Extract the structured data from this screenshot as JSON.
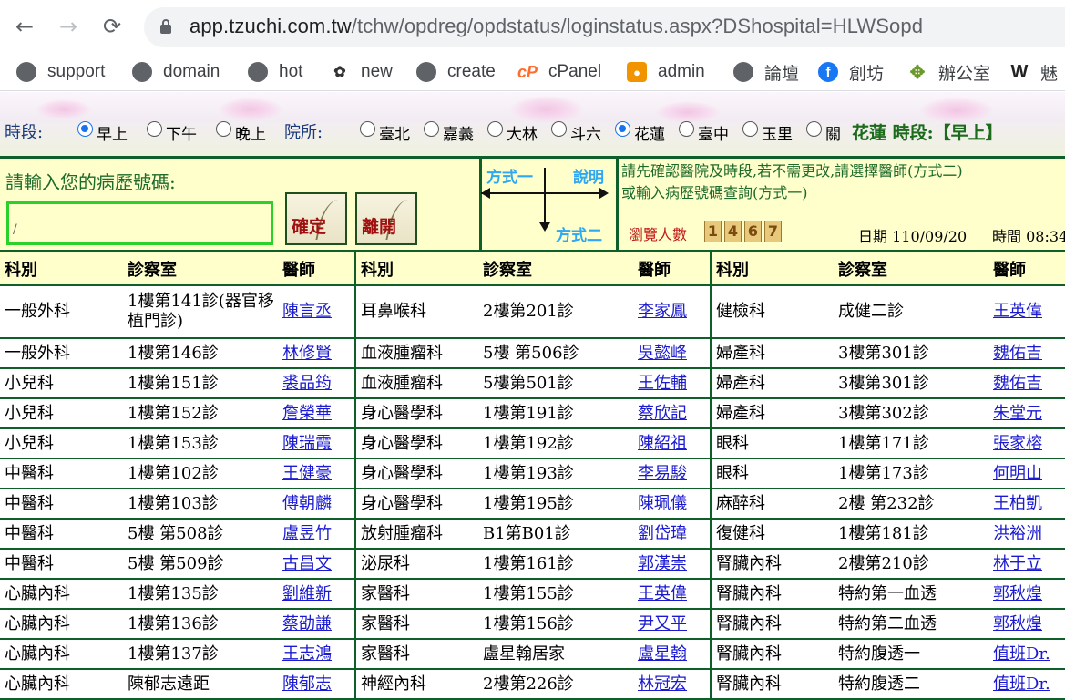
{
  "browser": {
    "back_icon": "←",
    "forward_icon": "→",
    "reload_icon": "⟳",
    "url_host": "app.tzuchi.com.tw",
    "url_path": "/tchw/opdreg/opdstatus/loginstatus.aspx?DShospital=HLWSopd"
  },
  "bookmarks": [
    {
      "label": "support",
      "icon": "globe-icon"
    },
    {
      "label": "domain",
      "icon": "globe-icon"
    },
    {
      "label": "hot",
      "icon": "globe-icon"
    },
    {
      "label": "new",
      "icon": "new-icon"
    },
    {
      "label": "create",
      "icon": "globe-icon"
    },
    {
      "label": "cPanel",
      "icon": "cpanel-icon"
    },
    {
      "label": "admin",
      "icon": "camera-icon"
    },
    {
      "label": "論壇",
      "icon": "globe-icon"
    },
    {
      "label": "創坊",
      "icon": "facebook-icon"
    },
    {
      "label": "辦公室",
      "icon": "leaf-icon"
    },
    {
      "label": "魅",
      "icon": "w-icon"
    }
  ],
  "session": {
    "period_label": "時段:",
    "periods": [
      {
        "label": "早上",
        "selected": true
      },
      {
        "label": "下午",
        "selected": false
      },
      {
        "label": "晚上",
        "selected": false
      }
    ],
    "campus_label": "院所:",
    "campuses": [
      {
        "label": "臺北",
        "selected": false
      },
      {
        "label": "嘉義",
        "selected": false
      },
      {
        "label": "大林",
        "selected": false
      },
      {
        "label": "斗六",
        "selected": false
      },
      {
        "label": "花蓮",
        "selected": true
      },
      {
        "label": "臺中",
        "selected": false
      },
      {
        "label": "玉里",
        "selected": false
      },
      {
        "label": "關",
        "selected": false
      }
    ],
    "status": "花蓮 時段:【早上】"
  },
  "form": {
    "prompt": "請輸入您的病歷號碼:",
    "input_value": "/",
    "confirm_label": "確定",
    "leave_label": "離開",
    "method_one": "方式一",
    "explain": "說明",
    "method_two": "方式二",
    "instructions_line1": "請先確認醫院及時段,若不需更改,請選擇醫師(方式二)",
    "instructions_line2": "或輸入病歷號碼查詢(方式一)",
    "visits_label": "瀏覽人數",
    "visits_digits": [
      "1",
      "4",
      "6",
      "7"
    ],
    "date": "日期 110/09/20",
    "time": "時間 08:34"
  },
  "table": {
    "headers": [
      "科別",
      "診察室",
      "醫師"
    ],
    "rows": [
      [
        [
          "一般外科",
          "1樓第141診(器官移植門診)",
          "陳言丞"
        ],
        [
          "耳鼻喉科",
          "2樓第201診",
          "李家鳳"
        ],
        [
          "健檢科",
          "成健二診",
          "王英偉"
        ]
      ],
      [
        [
          "一般外科",
          "1樓第146診",
          "林修賢"
        ],
        [
          "血液腫瘤科",
          "5樓 第506診",
          "吳懿峰"
        ],
        [
          "婦產科",
          "3樓第301診",
          "魏佑吉"
        ]
      ],
      [
        [
          "小兒科",
          "1樓第151診",
          "裘品筠"
        ],
        [
          "血液腫瘤科",
          "5樓第501診",
          "王佐輔"
        ],
        [
          "婦產科",
          "3樓第301診",
          "魏佑吉"
        ]
      ],
      [
        [
          "小兒科",
          "1樓第152診",
          "詹榮華"
        ],
        [
          "身心醫學科",
          "1樓第191診",
          "蔡欣記"
        ],
        [
          "婦產科",
          "3樓第302診",
          "朱堂元"
        ]
      ],
      [
        [
          "小兒科",
          "1樓第153診",
          "陳瑞霞"
        ],
        [
          "身心醫學科",
          "1樓第192診",
          "陳紹祖"
        ],
        [
          "眼科",
          "1樓第171診",
          "張家榕"
        ]
      ],
      [
        [
          "中醫科",
          "1樓第102診",
          "王健豪"
        ],
        [
          "身心醫學科",
          "1樓第193診",
          "李易駿"
        ],
        [
          "眼科",
          "1樓第173診",
          "何明山"
        ]
      ],
      [
        [
          "中醫科",
          "1樓第103診",
          "傅朝麟"
        ],
        [
          "身心醫學科",
          "1樓第195診",
          "陳珮儀"
        ],
        [
          "麻醉科",
          "2樓 第232診",
          "王柏凱"
        ]
      ],
      [
        [
          "中醫科",
          "5樓 第508診",
          "盧昱竹"
        ],
        [
          "放射腫瘤科",
          "B1第B01診",
          "劉岱瑋"
        ],
        [
          "復健科",
          "1樓第181診",
          "洪裕洲"
        ]
      ],
      [
        [
          "中醫科",
          "5樓 第509診",
          "古昌文"
        ],
        [
          "泌尿科",
          "1樓第161診",
          "郭漢崇"
        ],
        [
          "腎臟內科",
          "2樓第210診",
          "林于立"
        ]
      ],
      [
        [
          "心臟內科",
          "1樓第135診",
          "劉維新"
        ],
        [
          "家醫科",
          "1樓第155診",
          "王英偉"
        ],
        [
          "腎臟內科",
          "特約第一血透",
          "郭秋煌"
        ]
      ],
      [
        [
          "心臟內科",
          "1樓第136診",
          "蔡劭謙"
        ],
        [
          "家醫科",
          "1樓第156診",
          "尹又平"
        ],
        [
          "腎臟內科",
          "特約第二血透",
          "郭秋煌"
        ]
      ],
      [
        [
          "心臟內科",
          "1樓第137診",
          "王志鴻"
        ],
        [
          "家醫科",
          "盧星翰居家",
          "盧星翰"
        ],
        [
          "腎臟內科",
          "特約腹透一",
          "值班Dr."
        ]
      ],
      [
        [
          "心臟內科",
          "陳郁志遠距",
          "陳郁志"
        ],
        [
          "神經內科",
          "2樓第226診",
          "林冠宏"
        ],
        [
          "腎臟內科",
          "特約腹透二",
          "值班Dr."
        ]
      ]
    ]
  }
}
